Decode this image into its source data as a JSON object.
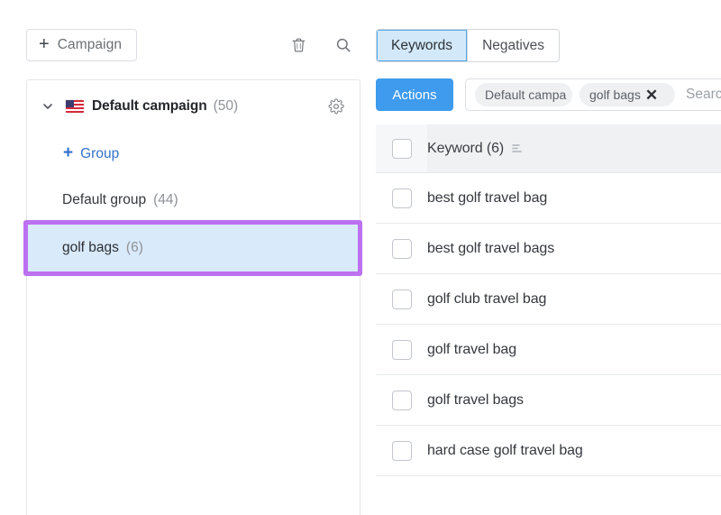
{
  "left_panel": {
    "toolbar": {
      "campaign_button_label": "Campaign",
      "add_glyph": "+",
      "delete_icon": "trash-icon",
      "search_icon": "search-icon"
    },
    "tree": {
      "campaign": {
        "name": "Default campaign",
        "count": "(50)",
        "flag": "us-flag-icon",
        "expanded_icon": "chevron-down-icon",
        "settings_icon": "gear-icon"
      },
      "add_group_label": "Group",
      "add_group_glyph": "+",
      "groups": [
        {
          "name": "Default group",
          "count": "(44)",
          "selected": false
        },
        {
          "name": "golf bags",
          "count": "(6)",
          "selected": true
        }
      ]
    }
  },
  "right_panel": {
    "tabs": [
      {
        "label": "Keywords",
        "active": true
      },
      {
        "label": "Negatives",
        "active": false
      }
    ],
    "filter_bar": {
      "actions_label": "Actions",
      "chips": [
        {
          "text": "Default campa",
          "removable": false
        },
        {
          "text": "golf bags",
          "removable": true,
          "remove_icon": "close-icon"
        }
      ],
      "search_placeholder": "Search"
    },
    "table": {
      "header": {
        "label": "Keyword (6)",
        "sort_icon": "sort-icon",
        "select_all_checkbox": "checkbox-unchecked"
      },
      "rows": [
        {
          "keyword": "best golf travel bag",
          "checked": false
        },
        {
          "keyword": "best golf travel bags",
          "checked": false
        },
        {
          "keyword": "golf club travel bag",
          "checked": false
        },
        {
          "keyword": "golf travel bag",
          "checked": false
        },
        {
          "keyword": "golf travel bags",
          "checked": false
        },
        {
          "keyword": "hard case golf travel bag",
          "checked": false
        }
      ]
    }
  },
  "colors": {
    "accent_blue": "#3e9bed",
    "link_blue": "#3272cc",
    "selected_row_blue": "#d9eafb",
    "annotation_purple": "#bb71f0",
    "tab_active_bg": "#d3e9fa",
    "tab_active_border": "#53a8e8",
    "header_gray": "#f0f1f2",
    "flag_red": "#d8283b",
    "flag_navy": "#3c3b6e"
  }
}
